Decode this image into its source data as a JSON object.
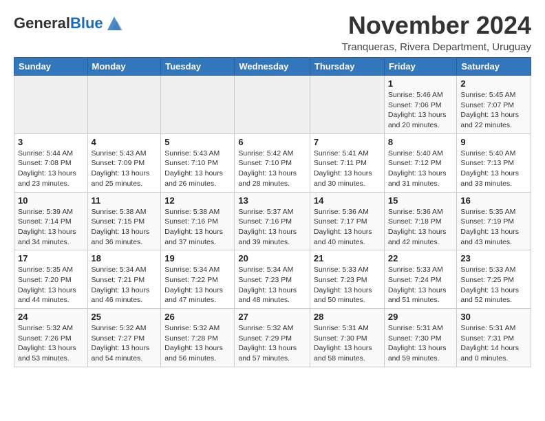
{
  "logo": {
    "general": "General",
    "blue": "Blue"
  },
  "header": {
    "month_year": "November 2024",
    "location": "Tranqueras, Rivera Department, Uruguay"
  },
  "days_of_week": [
    "Sunday",
    "Monday",
    "Tuesday",
    "Wednesday",
    "Thursday",
    "Friday",
    "Saturday"
  ],
  "weeks": [
    [
      {
        "day": "",
        "info": ""
      },
      {
        "day": "",
        "info": ""
      },
      {
        "day": "",
        "info": ""
      },
      {
        "day": "",
        "info": ""
      },
      {
        "day": "",
        "info": ""
      },
      {
        "day": "1",
        "info": "Sunrise: 5:46 AM\nSunset: 7:06 PM\nDaylight: 13 hours and 20 minutes."
      },
      {
        "day": "2",
        "info": "Sunrise: 5:45 AM\nSunset: 7:07 PM\nDaylight: 13 hours and 22 minutes."
      }
    ],
    [
      {
        "day": "3",
        "info": "Sunrise: 5:44 AM\nSunset: 7:08 PM\nDaylight: 13 hours and 23 minutes."
      },
      {
        "day": "4",
        "info": "Sunrise: 5:43 AM\nSunset: 7:09 PM\nDaylight: 13 hours and 25 minutes."
      },
      {
        "day": "5",
        "info": "Sunrise: 5:43 AM\nSunset: 7:10 PM\nDaylight: 13 hours and 26 minutes."
      },
      {
        "day": "6",
        "info": "Sunrise: 5:42 AM\nSunset: 7:10 PM\nDaylight: 13 hours and 28 minutes."
      },
      {
        "day": "7",
        "info": "Sunrise: 5:41 AM\nSunset: 7:11 PM\nDaylight: 13 hours and 30 minutes."
      },
      {
        "day": "8",
        "info": "Sunrise: 5:40 AM\nSunset: 7:12 PM\nDaylight: 13 hours and 31 minutes."
      },
      {
        "day": "9",
        "info": "Sunrise: 5:40 AM\nSunset: 7:13 PM\nDaylight: 13 hours and 33 minutes."
      }
    ],
    [
      {
        "day": "10",
        "info": "Sunrise: 5:39 AM\nSunset: 7:14 PM\nDaylight: 13 hours and 34 minutes."
      },
      {
        "day": "11",
        "info": "Sunrise: 5:38 AM\nSunset: 7:15 PM\nDaylight: 13 hours and 36 minutes."
      },
      {
        "day": "12",
        "info": "Sunrise: 5:38 AM\nSunset: 7:16 PM\nDaylight: 13 hours and 37 minutes."
      },
      {
        "day": "13",
        "info": "Sunrise: 5:37 AM\nSunset: 7:16 PM\nDaylight: 13 hours and 39 minutes."
      },
      {
        "day": "14",
        "info": "Sunrise: 5:36 AM\nSunset: 7:17 PM\nDaylight: 13 hours and 40 minutes."
      },
      {
        "day": "15",
        "info": "Sunrise: 5:36 AM\nSunset: 7:18 PM\nDaylight: 13 hours and 42 minutes."
      },
      {
        "day": "16",
        "info": "Sunrise: 5:35 AM\nSunset: 7:19 PM\nDaylight: 13 hours and 43 minutes."
      }
    ],
    [
      {
        "day": "17",
        "info": "Sunrise: 5:35 AM\nSunset: 7:20 PM\nDaylight: 13 hours and 44 minutes."
      },
      {
        "day": "18",
        "info": "Sunrise: 5:34 AM\nSunset: 7:21 PM\nDaylight: 13 hours and 46 minutes."
      },
      {
        "day": "19",
        "info": "Sunrise: 5:34 AM\nSunset: 7:22 PM\nDaylight: 13 hours and 47 minutes."
      },
      {
        "day": "20",
        "info": "Sunrise: 5:34 AM\nSunset: 7:23 PM\nDaylight: 13 hours and 48 minutes."
      },
      {
        "day": "21",
        "info": "Sunrise: 5:33 AM\nSunset: 7:23 PM\nDaylight: 13 hours and 50 minutes."
      },
      {
        "day": "22",
        "info": "Sunrise: 5:33 AM\nSunset: 7:24 PM\nDaylight: 13 hours and 51 minutes."
      },
      {
        "day": "23",
        "info": "Sunrise: 5:33 AM\nSunset: 7:25 PM\nDaylight: 13 hours and 52 minutes."
      }
    ],
    [
      {
        "day": "24",
        "info": "Sunrise: 5:32 AM\nSunset: 7:26 PM\nDaylight: 13 hours and 53 minutes."
      },
      {
        "day": "25",
        "info": "Sunrise: 5:32 AM\nSunset: 7:27 PM\nDaylight: 13 hours and 54 minutes."
      },
      {
        "day": "26",
        "info": "Sunrise: 5:32 AM\nSunset: 7:28 PM\nDaylight: 13 hours and 56 minutes."
      },
      {
        "day": "27",
        "info": "Sunrise: 5:32 AM\nSunset: 7:29 PM\nDaylight: 13 hours and 57 minutes."
      },
      {
        "day": "28",
        "info": "Sunrise: 5:31 AM\nSunset: 7:30 PM\nDaylight: 13 hours and 58 minutes."
      },
      {
        "day": "29",
        "info": "Sunrise: 5:31 AM\nSunset: 7:30 PM\nDaylight: 13 hours and 59 minutes."
      },
      {
        "day": "30",
        "info": "Sunrise: 5:31 AM\nSunset: 7:31 PM\nDaylight: 14 hours and 0 minutes."
      }
    ]
  ]
}
